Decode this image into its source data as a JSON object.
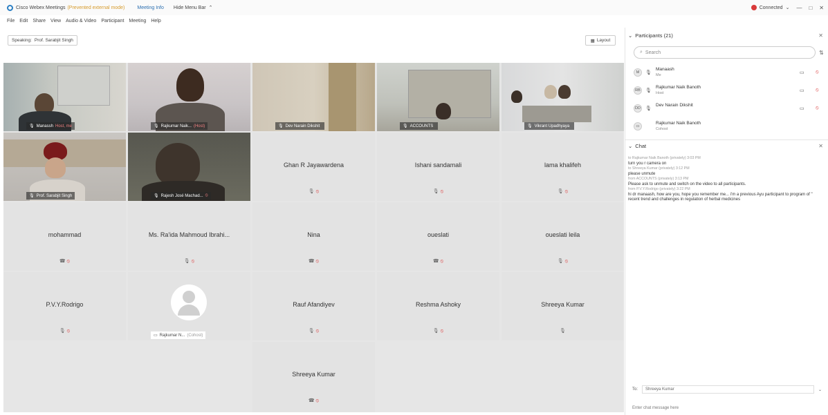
{
  "window": {
    "title": "Cisco Webex Meetings",
    "mode": "(Prevented external mode)",
    "meeting_info": "Meeting Info",
    "hide_menu": "Hide Menu Bar",
    "connection": "Connected",
    "win_controls": [
      "—",
      "□",
      "✕"
    ]
  },
  "menu": [
    "File",
    "Edit",
    "Share",
    "View",
    "Audio & Video",
    "Participant",
    "Meeting",
    "Help"
  ],
  "speaking": {
    "label": "Speaking:",
    "name": "Prof. Sarabjit Singh"
  },
  "layout_label": "Layout",
  "video_tiles": [
    {
      "name": "Manassh",
      "extra": "Host, me"
    },
    {
      "name": "Rajkumar Naik...",
      "extra": "(Host)"
    },
    {
      "name": "Dev Narain Dikshit",
      "extra": ""
    },
    {
      "name": "ACCOUNTS",
      "extra": ""
    },
    {
      "name": "Vikrant Upadhyaya",
      "extra": ""
    },
    {
      "name": "Prof. Sarabjit Singh",
      "extra": ""
    },
    {
      "name": "Rajesh José Machad...",
      "extra": ""
    }
  ],
  "name_tiles": [
    {
      "name": "Ghan R Jayawardena"
    },
    {
      "name": "Ishani sandamali"
    },
    {
      "name": "lama khalifeh"
    },
    {
      "name": "mohammad"
    },
    {
      "name": "Ms. Ra'ida Mahmoud Ibrahi..."
    },
    {
      "name": "Nina"
    },
    {
      "name": "oueslati"
    },
    {
      "name": "oueslati leila"
    },
    {
      "name": "P.V.Y.Rodrigo"
    },
    {
      "name": "Rauf Afandiyev"
    },
    {
      "name": "Reshma Ashoky"
    },
    {
      "name": "Shreeya Kumar"
    },
    {
      "name": "Shreeya Kumar"
    }
  ],
  "avatar_tile": {
    "name": "Rajkumar N...",
    "extra": "(Cohost)"
  },
  "participants": {
    "title": "Participants (21)",
    "search_placeholder": "Search",
    "items": [
      {
        "initials": "M",
        "name": "Manaash",
        "role": "Me"
      },
      {
        "initials": "RB",
        "name": "Rajkumar Naik Banoth",
        "role": "Host"
      },
      {
        "initials": "DD",
        "name": "Dev Narain Dikshit",
        "role": ""
      },
      {
        "initials": "RB",
        "name": "Rajkumar Naik Banoth",
        "role": "Cohost"
      }
    ]
  },
  "chat": {
    "title": "Chat",
    "messages": [
      {
        "meta": "to Rajkumar Naik Banoth (privately)   3:03 PM",
        "text": "turn you r camera on"
      },
      {
        "meta": "to Shreeya Kumar (privately)   3:12 PM",
        "text": "please unmute"
      },
      {
        "meta": "from ACCOUNTS (privately)   3:13 PM",
        "text": "Please ask to unmute and switch on the video to all participants."
      },
      {
        "meta": "from P.V.Y.Rodrigo (privately)   3:22 PM",
        "text": "hi dr manaash, how are you, hope you remember me... i'm a previous Ayu participant to program of \" recent trend and challenges in regulation of herbal medicines"
      }
    ],
    "to_label": "To:",
    "to_value": "Shreeya Kumar",
    "input_placeholder": "Enter chat message here"
  },
  "colors": {
    "accent": "#3aa0d8",
    "mute": "#dd4444",
    "connected_dot": "#d93a3a"
  }
}
